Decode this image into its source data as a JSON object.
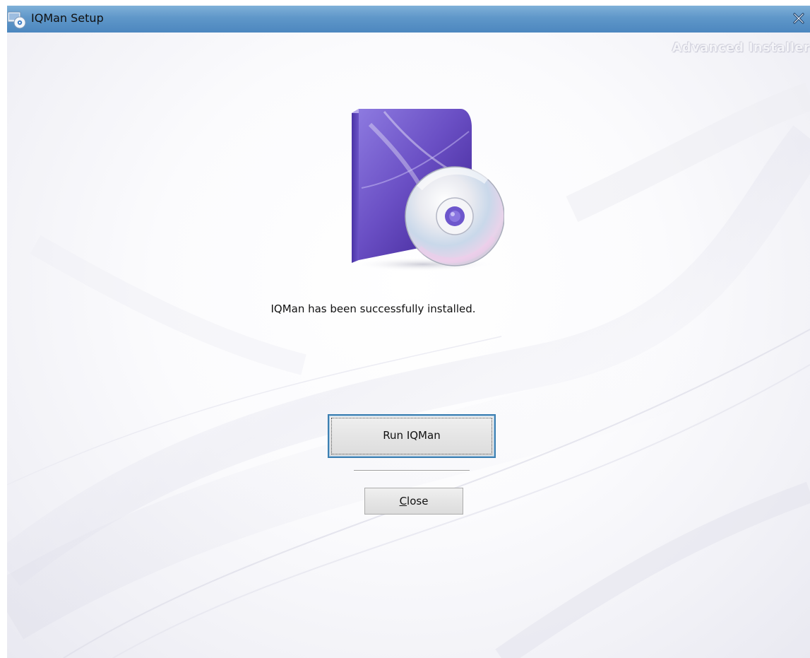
{
  "window": {
    "title": "IQMan Setup",
    "icon": "setup-installer-icon",
    "close_icon": "close-icon",
    "titlebar_color": "#5f97c9"
  },
  "branding": {
    "text": "Advanced Installer"
  },
  "product_image": {
    "icon": "software-box-with-cd-icon",
    "box_color": "#6a4fc4"
  },
  "main": {
    "message": "IQMan has been successfully installed."
  },
  "buttons": {
    "run_label": "Run IQMan",
    "close_label_mnemonic": "C",
    "close_label_rest": "lose",
    "focus_color": "#3c7fb1"
  }
}
